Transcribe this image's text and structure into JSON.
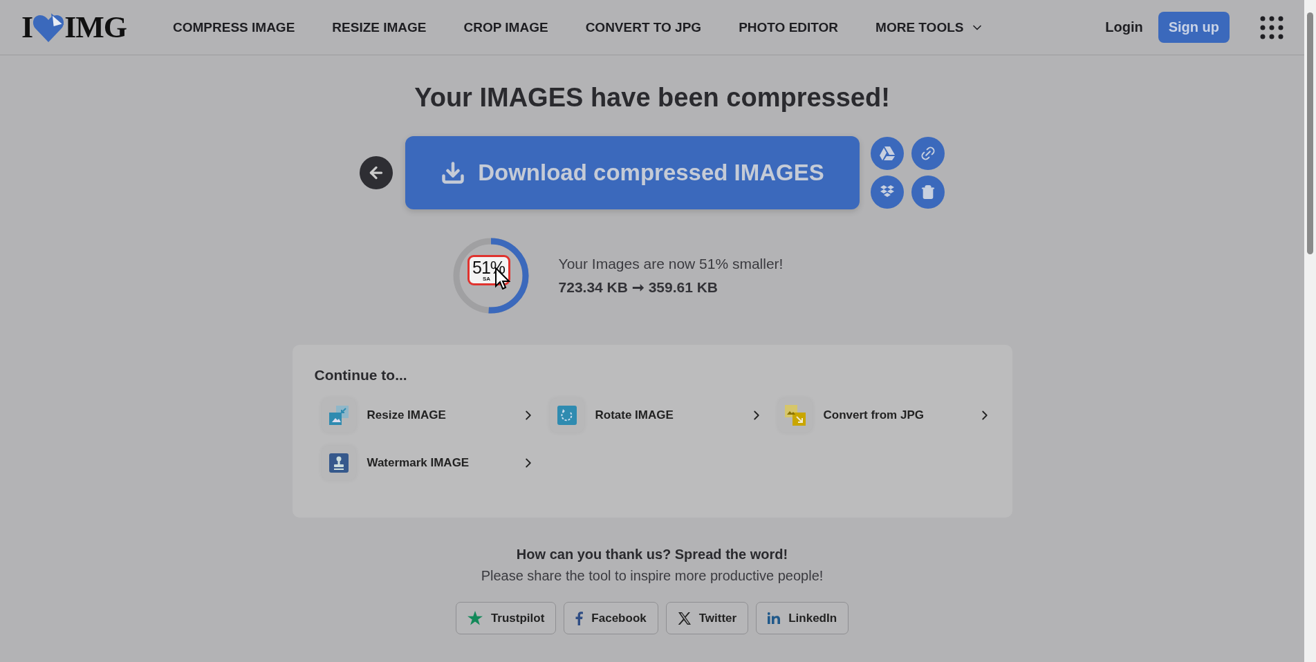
{
  "header": {
    "logo": {
      "left": "I",
      "right": "IMG"
    },
    "nav": [
      {
        "label": "COMPRESS IMAGE",
        "dropdown": false
      },
      {
        "label": "RESIZE IMAGE",
        "dropdown": false
      },
      {
        "label": "CROP IMAGE",
        "dropdown": false
      },
      {
        "label": "CONVERT TO JPG",
        "dropdown": false
      },
      {
        "label": "PHOTO EDITOR",
        "dropdown": false
      },
      {
        "label": "MORE TOOLS",
        "dropdown": true
      }
    ],
    "login": "Login",
    "signup": "Sign up"
  },
  "title": "Your IMAGES have been compressed!",
  "download": {
    "label": "Download compressed IMAGES"
  },
  "side_actions": [
    {
      "kind": "drive"
    },
    {
      "kind": "link"
    },
    {
      "kind": "dropbox"
    },
    {
      "kind": "delete"
    }
  ],
  "result": {
    "level": 0.51,
    "percent": "51%",
    "caption": "SA",
    "highlighted": true,
    "message": "Your Images are now 51% smaller!",
    "before": "723.34 KB",
    "arrow": "➞",
    "after": "359.61 KB"
  },
  "continue": {
    "heading": "Continue to...",
    "items": [
      {
        "kind": "resize",
        "label": "Resize IMAGE"
      },
      {
        "kind": "rotate",
        "label": "Rotate IMAGE"
      },
      {
        "kind": "convert",
        "label": "Convert from JPG"
      },
      {
        "kind": "watermark",
        "label": "Watermark IMAGE"
      }
    ]
  },
  "share": {
    "heading": "How can you thank us? Spread the word!",
    "subtitle": "Please share the tool to inspire more productive people!",
    "buttons": [
      {
        "kind": "trustpilot",
        "label": "Trustpilot"
      },
      {
        "kind": "facebook",
        "label": "Facebook"
      },
      {
        "kind": "twitter",
        "label": "Twitter"
      },
      {
        "kind": "linkedin",
        "label": "LinkedIn"
      }
    ]
  }
}
